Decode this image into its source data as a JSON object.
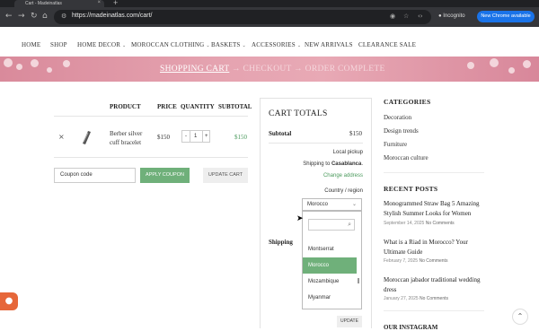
{
  "browser": {
    "tab_title": "Cart - Madeinatlas",
    "url": "https://madeinatlas.com/cart/",
    "incognito_label": "Incognito",
    "chrome_available_label": "New Chrome available"
  },
  "nav": {
    "items": [
      {
        "label": "HOME"
      },
      {
        "label": "SHOP"
      },
      {
        "label": "HOME DECOR"
      },
      {
        "label": "MOROCCAN CLOTHING"
      },
      {
        "label": "BASKETS"
      },
      {
        "label": "ACCESSORIES"
      },
      {
        "label": "NEW ARRIVALS"
      },
      {
        "label": "CLEARANCE SALE"
      }
    ]
  },
  "steps": {
    "cart": "SHOPPING CART",
    "checkout": "CHECKOUT",
    "complete": "ORDER COMPLETE",
    "arrow": "→"
  },
  "cart_table": {
    "headers": {
      "product": "PRODUCT",
      "price": "PRICE",
      "quantity": "QUANTITY",
      "subtotal": "SUBTOTAL"
    },
    "rows": [
      {
        "name": "Berber silver cuff bracelet",
        "price": "$150",
        "qty": "1",
        "subtotal": "$150"
      }
    ],
    "coupon_placeholder": "Coupon code",
    "apply_coupon": "APPLY COUPON",
    "update_cart": "UPDATE CART"
  },
  "totals": {
    "title": "CART TOTALS",
    "subtotal_label": "Subtotal",
    "subtotal_value": "$150",
    "shipping_label": "Shipping",
    "local_pickup": "Local pickup",
    "shipping_to": "Shipping to ",
    "shipping_city": "Casablanca",
    "change_address": "Change address",
    "country_label": "Country / region",
    "country_selected": "Morocco",
    "options": [
      "Montserrat",
      "Morocco",
      "Mozambique",
      "Myanmar"
    ],
    "selected_index": 1,
    "update_label": "UPDATE"
  },
  "sidebar": {
    "categories_title": "CATEGORIES",
    "categories": [
      "Decoration",
      "Design trends",
      "Furniture",
      "Moroccan culture"
    ],
    "recent_title": "RECENT POSTS",
    "posts": [
      {
        "title": "Monogrammed Straw Bag 5 Amazing Stylish Summer Looks for Women",
        "date": "September 14, 2025",
        "comments": "No Comments"
      },
      {
        "title": "What is a Riad in Morocco? Your Ultimate Guide",
        "date": "February 7, 2025",
        "comments": "No Comments"
      },
      {
        "title": "Moroccan jabador traditional wedding dress",
        "date": "January 27, 2025",
        "comments": "No Comments"
      }
    ],
    "cut_heading": "OUR INSTAGRAM"
  },
  "colors": {
    "accent_green": "#6fb07a",
    "banner_pink": "#e5a3b0",
    "cookie_orange": "#e6673a",
    "chrome_blue": "#1a73e8"
  }
}
